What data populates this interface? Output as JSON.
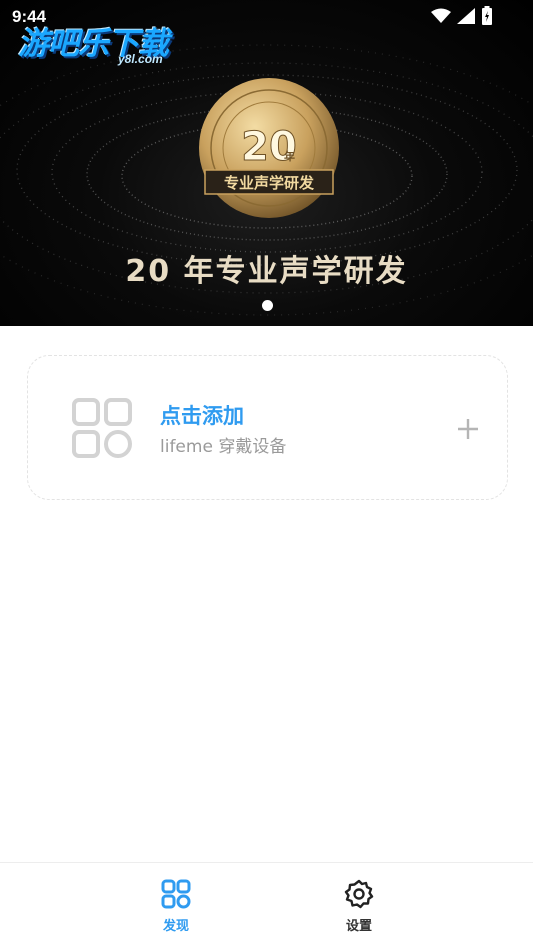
{
  "status_bar": {
    "time": "9:44"
  },
  "watermark": {
    "title": "游吧乐下载",
    "site": "y8l.com"
  },
  "banner": {
    "medal_number": "20",
    "medal_year_char": "年",
    "medal_ribbon": "专业声学研发",
    "caption": "20 年专业声学研发",
    "pager_index": 1,
    "pager_count": 1
  },
  "add_device": {
    "title": "点击添加",
    "subtitle": "lifeme 穿戴设备"
  },
  "bottom_nav": {
    "items": [
      {
        "label": "发现",
        "icon": "grid-icon",
        "active": true
      },
      {
        "label": "设置",
        "icon": "gear-icon",
        "active": false
      }
    ]
  },
  "colors": {
    "accent": "#2f9bf0",
    "banner_text": "#e8dcc4",
    "medal_gold": "#c9a15e"
  }
}
